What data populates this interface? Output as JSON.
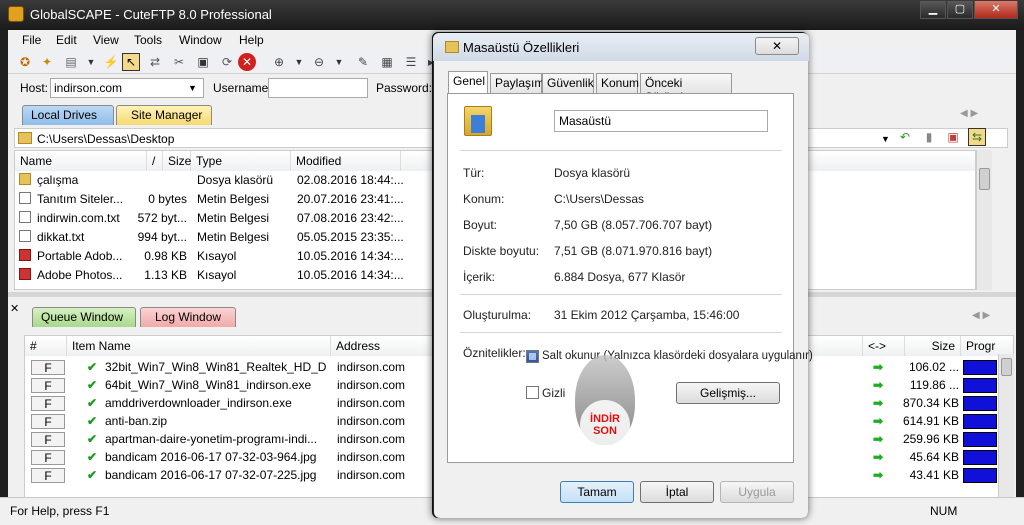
{
  "window": {
    "title": "GlobalSCAPE - CuteFTP 8.0 Professional",
    "minimize": "▁",
    "maximize": "▢",
    "close": "✕"
  },
  "menu": [
    "File",
    "Edit",
    "View",
    "Tools",
    "Window",
    "Help"
  ],
  "hostbar": {
    "host_label": "Host:",
    "host_value": "indirson.com",
    "user_label": "Username:",
    "user_value": "",
    "pass_label": "Password:"
  },
  "top_tabs": [
    "Local Drives",
    "Site Manager"
  ],
  "path": "C:\\Users\\Dessas\\Desktop",
  "file_columns": [
    "Name",
    "/",
    "Size",
    "Type",
    "Modified"
  ],
  "files": [
    {
      "icon": "folder",
      "name": "çalışma",
      "size": "",
      "type": "Dosya klasörü",
      "modified": "02.08.2016 18:44:..."
    },
    {
      "icon": "doc",
      "name": "Tanıtım Siteler...",
      "size": "0 bytes",
      "type": "Metin Belgesi",
      "modified": "20.07.2016 23:41:..."
    },
    {
      "icon": "doc",
      "name": "indirwin.com.txt",
      "size": "572 byt...",
      "type": "Metin Belgesi",
      "modified": "07.08.2016 23:42:..."
    },
    {
      "icon": "doc",
      "name": "dikkat.txt",
      "size": "994 byt...",
      "type": "Metin Belgesi",
      "modified": "05.05.2015 23:35:..."
    },
    {
      "icon": "lnk",
      "name": "Portable Adob...",
      "size": "0.98 KB",
      "type": "Kısayol",
      "modified": "10.05.2016 14:34:..."
    },
    {
      "icon": "lnk",
      "name": "Adobe Photos...",
      "size": "1.13 KB",
      "type": "Kısayol",
      "modified": "10.05.2016 14:34:..."
    }
  ],
  "bottom_tabs": [
    "Queue Window",
    "Log Window"
  ],
  "queue_columns": [
    "#",
    "Item Name",
    "Address",
    "<->",
    "Size",
    "Progr"
  ],
  "queue": [
    {
      "flag": "F",
      "name": "32bit_Win7_Win8_Win81_Realtek_HD_Dr...",
      "address": "indirson.com",
      "size": "106.02 ..."
    },
    {
      "flag": "F",
      "name": "64bit_Win7_Win8_Win81_indirson.exe",
      "address": "indirson.com",
      "size": "119.86 ..."
    },
    {
      "flag": "F",
      "name": "amddriverdownloader_indirson.exe",
      "address": "indirson.com",
      "size": "870.34 KB"
    },
    {
      "flag": "F",
      "name": "anti-ban.zip",
      "address": "indirson.com",
      "size": "614.91 KB"
    },
    {
      "flag": "F",
      "name": "apartman-daire-yonetim-programı-indi...",
      "address": "indirson.com",
      "size": "259.96 KB"
    },
    {
      "flag": "F",
      "name": "bandicam 2016-06-17 07-32-03-964.jpg",
      "address": "indirson.com",
      "size": "45.64 KB"
    },
    {
      "flag": "F",
      "name": "bandicam 2016-06-17 07-32-07-225.jpg",
      "address": "indirson.com",
      "size": "43.41 KB"
    }
  ],
  "status": {
    "help": "For Help, press F1",
    "num": "NUM"
  },
  "dialog": {
    "title": "Masaüstü Özellikleri",
    "close": "✕",
    "tabs": [
      "Genel",
      "Paylaşım",
      "Güvenlik",
      "Konum",
      "Önceki Sürümler"
    ],
    "name": "Masaüstü",
    "props": [
      {
        "label": "Tür:",
        "value": "Dosya klasörü"
      },
      {
        "label": "Konum:",
        "value": "C:\\Users\\Dessas"
      },
      {
        "label": "Boyut:",
        "value": "7,50 GB (8.057.706.707 bayt)"
      },
      {
        "label": "Diskte boyutu:",
        "value": "7,51 GB (8.071.970.816 bayt)"
      },
      {
        "label": "İçerik:",
        "value": "6.884 Dosya, 677 Klasör"
      }
    ],
    "created_label": "Oluşturulma:",
    "created_value": "31 Ekim 2012 Çarşamba, 15:46:00",
    "attributes_label": "Öznitelikler:",
    "readonly_label": "Salt okunur (Yalnızca klasördeki dosyalara uygulanır)",
    "readonly_checked": true,
    "hidden_label": "Gizli",
    "hidden_checked": false,
    "advanced_button": "Gelişmiş...",
    "ok_button": "Tamam",
    "cancel_button": "İptal",
    "apply_button": "Uygula"
  },
  "watermark": [
    "İNDİR",
    "SON"
  ]
}
